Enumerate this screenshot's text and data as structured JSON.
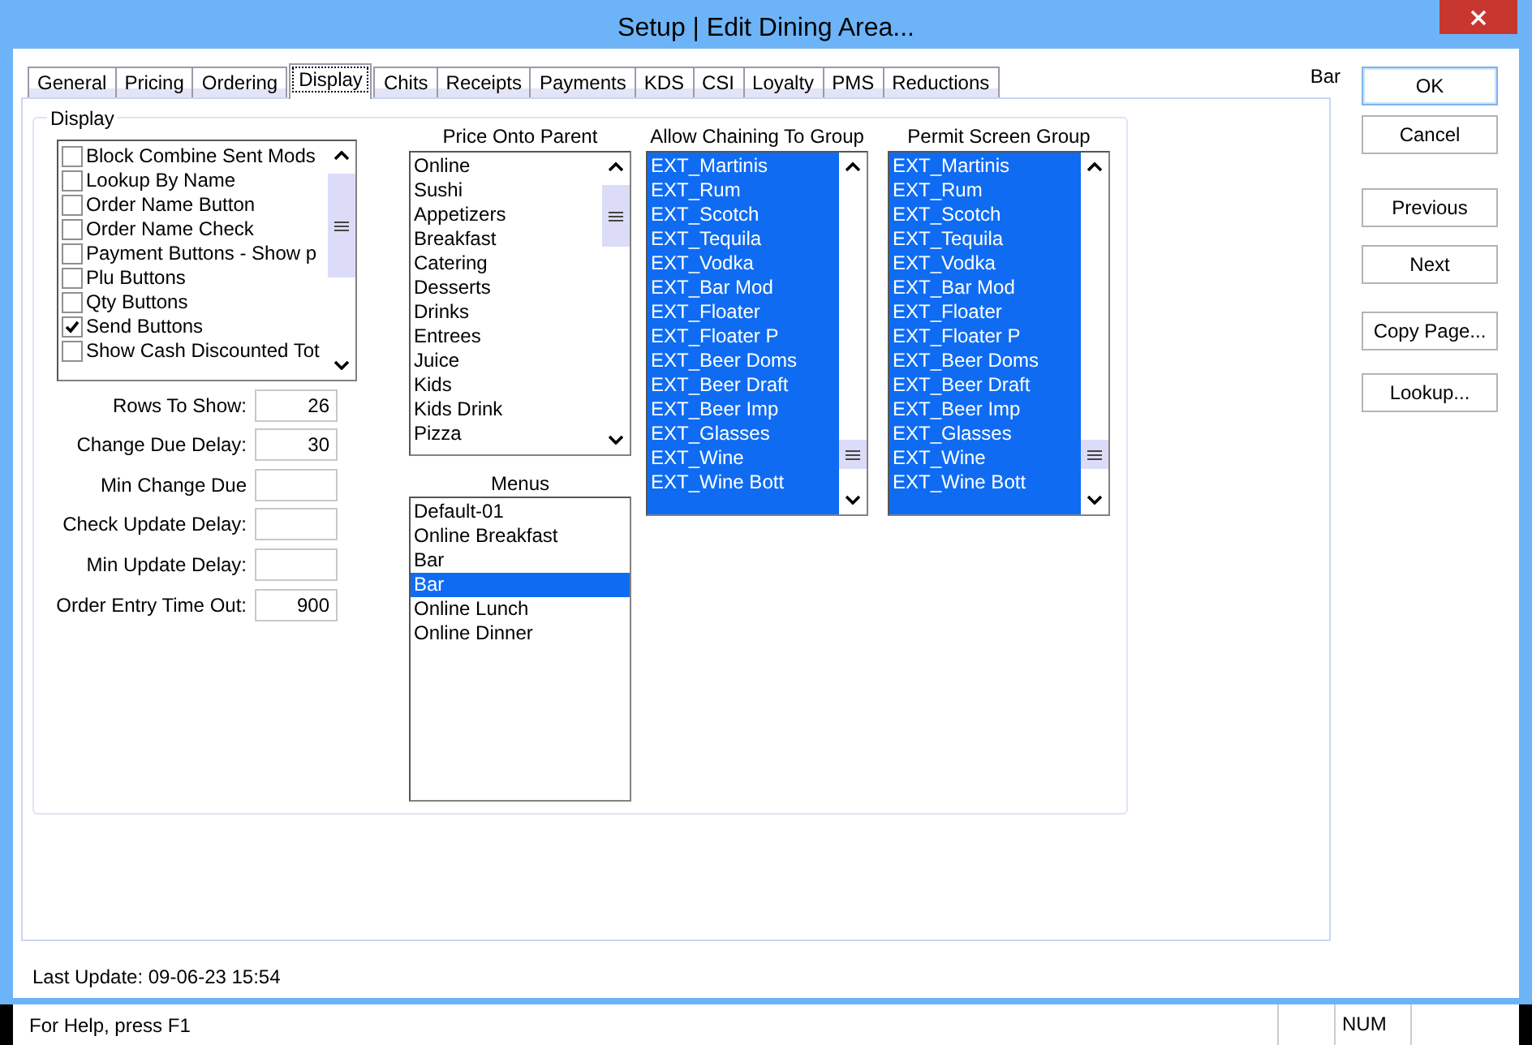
{
  "window": {
    "title": "Setup | Edit Dining Area..."
  },
  "tabs": [
    {
      "label": "General",
      "selected": false
    },
    {
      "label": "Pricing",
      "selected": false
    },
    {
      "label": "Ordering",
      "selected": false
    },
    {
      "label": "Display",
      "selected": true
    },
    {
      "label": "Chits",
      "selected": false
    },
    {
      "label": "Receipts",
      "selected": false
    },
    {
      "label": "Payments",
      "selected": false
    },
    {
      "label": "KDS",
      "selected": false
    },
    {
      "label": "CSI",
      "selected": false
    },
    {
      "label": "Loyalty",
      "selected": false
    },
    {
      "label": "PMS",
      "selected": false
    },
    {
      "label": "Reductions",
      "selected": false
    }
  ],
  "record_name": "Bar",
  "display_group": {
    "title": "Display",
    "options": [
      {
        "label": "Block Combine Sent Mods",
        "checked": false
      },
      {
        "label": "Lookup By Name",
        "checked": false
      },
      {
        "label": "Order Name Button",
        "checked": false
      },
      {
        "label": "Order Name Check",
        "checked": false
      },
      {
        "label": "Payment Buttons - Show p",
        "checked": false
      },
      {
        "label": "Plu Buttons",
        "checked": false
      },
      {
        "label": "Qty Buttons",
        "checked": false
      },
      {
        "label": "Send Buttons",
        "checked": true
      },
      {
        "label": "Show Cash Discounted Tot",
        "checked": false
      }
    ],
    "fields": [
      {
        "label": "Rows To Show:",
        "value": "26"
      },
      {
        "label": "Change Due Delay:",
        "value": "30"
      },
      {
        "label": "Min Change Due"
      },
      {
        "label": "Check Update Delay:"
      },
      {
        "label": "Min Update Delay:"
      },
      {
        "label": "Order Entry Time Out:",
        "value": "900"
      }
    ],
    "price_onto_parent": {
      "title": "Price Onto Parent",
      "items": [
        {
          "label": "Online",
          "selected": false
        },
        {
          "label": "Sushi",
          "selected": false
        },
        {
          "label": "Appetizers",
          "selected": false
        },
        {
          "label": "Breakfast",
          "selected": false
        },
        {
          "label": "Catering",
          "selected": false
        },
        {
          "label": "Desserts",
          "selected": false
        },
        {
          "label": "Drinks",
          "selected": false
        },
        {
          "label": "Entrees",
          "selected": false
        },
        {
          "label": "Juice",
          "selected": false
        },
        {
          "label": "Kids",
          "selected": false
        },
        {
          "label": "Kids Drink",
          "selected": false
        },
        {
          "label": "Pizza",
          "selected": false
        }
      ]
    },
    "menus": {
      "title": "Menus",
      "items": [
        {
          "label": "Default-01",
          "selected": false
        },
        {
          "label": "Online Breakfast",
          "selected": false
        },
        {
          "label": "Bar",
          "selected": false
        },
        {
          "label": "Bar",
          "selected": true
        },
        {
          "label": "Online Lunch",
          "selected": false
        },
        {
          "label": "Online Dinner",
          "selected": false
        }
      ]
    },
    "allow_chaining_to_group": {
      "title": "Allow Chaining To Group",
      "items": [
        {
          "label": "EXT_Martinis",
          "selected": true
        },
        {
          "label": "EXT_Rum",
          "selected": true
        },
        {
          "label": "EXT_Scotch",
          "selected": true
        },
        {
          "label": "EXT_Tequila",
          "selected": true
        },
        {
          "label": "EXT_Vodka",
          "selected": true
        },
        {
          "label": "EXT_Bar Mod",
          "selected": true
        },
        {
          "label": "EXT_Floater",
          "selected": true
        },
        {
          "label": "EXT_Floater P",
          "selected": true
        },
        {
          "label": "EXT_Beer Doms",
          "selected": true
        },
        {
          "label": "EXT_Beer Draft",
          "selected": true
        },
        {
          "label": "EXT_Beer Imp",
          "selected": true
        },
        {
          "label": "EXT_Glasses",
          "selected": true
        },
        {
          "label": "EXT_Wine",
          "selected": true
        },
        {
          "label": "EXT_Wine Bott",
          "selected": true
        }
      ]
    },
    "permit_screen_group": {
      "title": "Permit Screen Group",
      "items": [
        {
          "label": "EXT_Martinis",
          "selected": true
        },
        {
          "label": "EXT_Rum",
          "selected": true
        },
        {
          "label": "EXT_Scotch",
          "selected": true
        },
        {
          "label": "EXT_Tequila",
          "selected": true
        },
        {
          "label": "EXT_Vodka",
          "selected": true
        },
        {
          "label": "EXT_Bar Mod",
          "selected": true
        },
        {
          "label": "EXT_Floater",
          "selected": true
        },
        {
          "label": "EXT_Floater P",
          "selected": true
        },
        {
          "label": "EXT_Beer Doms",
          "selected": true
        },
        {
          "label": "EXT_Beer Draft",
          "selected": true
        },
        {
          "label": "EXT_Beer Imp",
          "selected": true
        },
        {
          "label": "EXT_Glasses",
          "selected": true
        },
        {
          "label": "EXT_Wine",
          "selected": true
        },
        {
          "label": "EXT_Wine Bott",
          "selected": true
        }
      ]
    }
  },
  "buttons": [
    {
      "label": "OK",
      "default": true
    },
    {
      "label": "Cancel",
      "default": false
    },
    {
      "label": "Previous",
      "default": false
    },
    {
      "label": "Next",
      "default": false
    },
    {
      "label": "Copy Page...",
      "default": false
    },
    {
      "label": "Lookup...",
      "default": false
    }
  ],
  "last_update": "Last Update: 09-06-23 15:54",
  "status_bar": {
    "message": "For Help, press F1",
    "indicator": "NUM"
  }
}
